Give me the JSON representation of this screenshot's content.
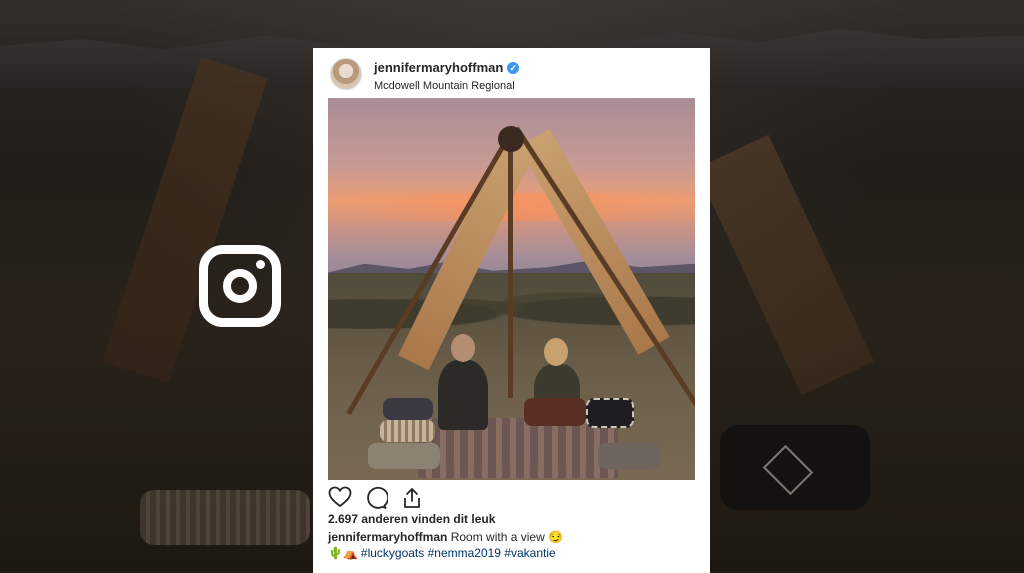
{
  "post": {
    "username": "jennifermaryhoffman",
    "verified_mark": "✓",
    "location": "Mcdowell Mountain Regional",
    "likes_text": "2.697 anderen vinden dit leuk",
    "caption_user": "jennifermaryhoffman",
    "caption_text": "Room with a view 😏",
    "emojis": "🌵⛺",
    "hashtags": "#luckygoats #nemma2019 #vakantie"
  },
  "icons": {
    "logo": "instagram-logo-icon",
    "like": "heart-icon",
    "comment": "comment-icon",
    "share": "share-icon",
    "verified": "verified-badge-icon"
  },
  "colors": {
    "link": "#003569",
    "verified": "#3897f0",
    "text": "#262626"
  }
}
